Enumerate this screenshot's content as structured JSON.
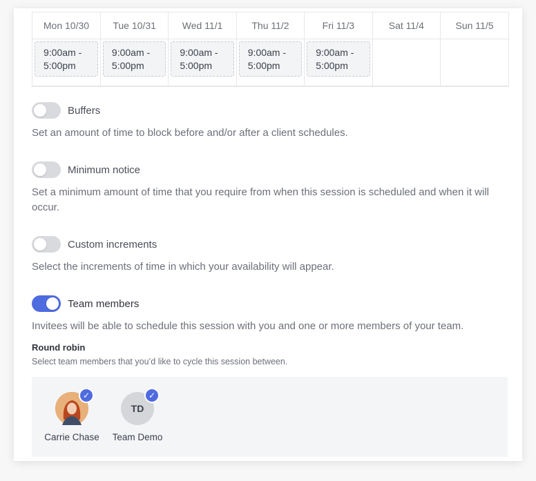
{
  "schedule": {
    "days": [
      "Mon 10/30",
      "Tue 10/31",
      "Wed 11/1",
      "Thu 11/2",
      "Fri 11/3",
      "Sat 11/4",
      "Sun 11/5"
    ],
    "slots": [
      "9:00am -\n5:00pm",
      "9:00am -\n5:00pm",
      "9:00am -\n5:00pm",
      "9:00am -\n5:00pm",
      "9:00am -\n5:00pm",
      "",
      ""
    ]
  },
  "settings": {
    "buffers": {
      "label": "Buffers",
      "enabled": false,
      "description": "Set an amount of time to block before and/or after a client schedules."
    },
    "minimum_notice": {
      "label": "Minimum notice",
      "enabled": false,
      "description": "Set a minimum amount of time that you require from when this session is scheduled and when it will occur."
    },
    "custom_increments": {
      "label": "Custom increments",
      "enabled": false,
      "description": "Select the increments of time in which your availability will appear."
    },
    "team_members": {
      "label": "Team members",
      "enabled": true,
      "description": "Invitees will be able to schedule this session with you and one or more members of your team."
    }
  },
  "round_robin": {
    "title": "Round robin",
    "subtitle": "Select team members that you’d like to cycle this session between.",
    "members": [
      {
        "name": "Carrie Chase",
        "initials": "",
        "selected": true
      },
      {
        "name": "Team Demo",
        "initials": "TD",
        "selected": true
      }
    ]
  },
  "colors": {
    "accent": "#4f6be0",
    "toggle_off": "#d9dadd",
    "panel_bg": "#f4f5f7"
  },
  "icons": {
    "check": "check-icon"
  }
}
